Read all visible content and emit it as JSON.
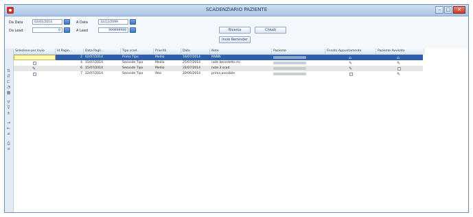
{
  "window": {
    "title": "SCADENZIARIO PAZIENTE",
    "controls": [
      "minimize",
      "maximize",
      "close"
    ]
  },
  "filters": {
    "da_data_label": "Da Data",
    "da_data_value": "01/01/2014",
    "a_data_label": "A Data",
    "a_data_value": "31/12/2099",
    "da_lead_label": "Da Lead",
    "da_lead_value": "0",
    "a_lead_label": "A Lead",
    "a_lead_value": "999999999",
    "ricerca_label": "Ricerca",
    "chiudi_label": "Chiudi",
    "invio_label": "Invio Reminder"
  },
  "table": {
    "columns": [
      "Selezione per Invio",
      "Id Pagin...",
      "Data Pagli...",
      "Tipo scad.",
      "Priorità",
      "Data",
      "Note",
      "Paziente",
      "Fissato Appuntamento",
      "Paziente Avvisato"
    ],
    "rows": [
      {
        "id": "2",
        "data_pag": "02/07/2014",
        "tipo": "Primo Tipo",
        "priorita": "Media",
        "data": "16/07/2014",
        "note": "NNNN"
      },
      {
        "id": "4",
        "data_pag": "15/07/2014",
        "tipo": "Secondo Tipo",
        "priorita": "Media",
        "data": "25/07/2014",
        "note": "note benedetto mi"
      },
      {
        "id": "6",
        "data_pag": "15/07/2014",
        "tipo": "Secondo Tipo",
        "priorita": "Media",
        "data": "31/07/2014",
        "note": "note 2 scad"
      },
      {
        "id": "7",
        "data_pag": "22/07/2014",
        "tipo": "Secondo Tipo",
        "priorita": "Alta",
        "data": "20/06/2014",
        "note": "prima possibile"
      }
    ]
  },
  "icons": {
    "calendar": "calendar-icon",
    "checkbox": "checkbox-icon",
    "toolstrip": [
      "sort-asc-icon",
      "sort-desc-icon",
      "group-icon",
      "filter-icon",
      "grid-icon",
      "funnel-icon",
      "funnel-remove-icon",
      "expand-icon",
      "indent-icon",
      "outdent-icon",
      "collapse-icon",
      "print-icon",
      "export-icon"
    ]
  },
  "colors": {
    "selected_row": "#2f5fa8",
    "title_bar": "#b9d0ea",
    "close_button": "#c43b28"
  }
}
